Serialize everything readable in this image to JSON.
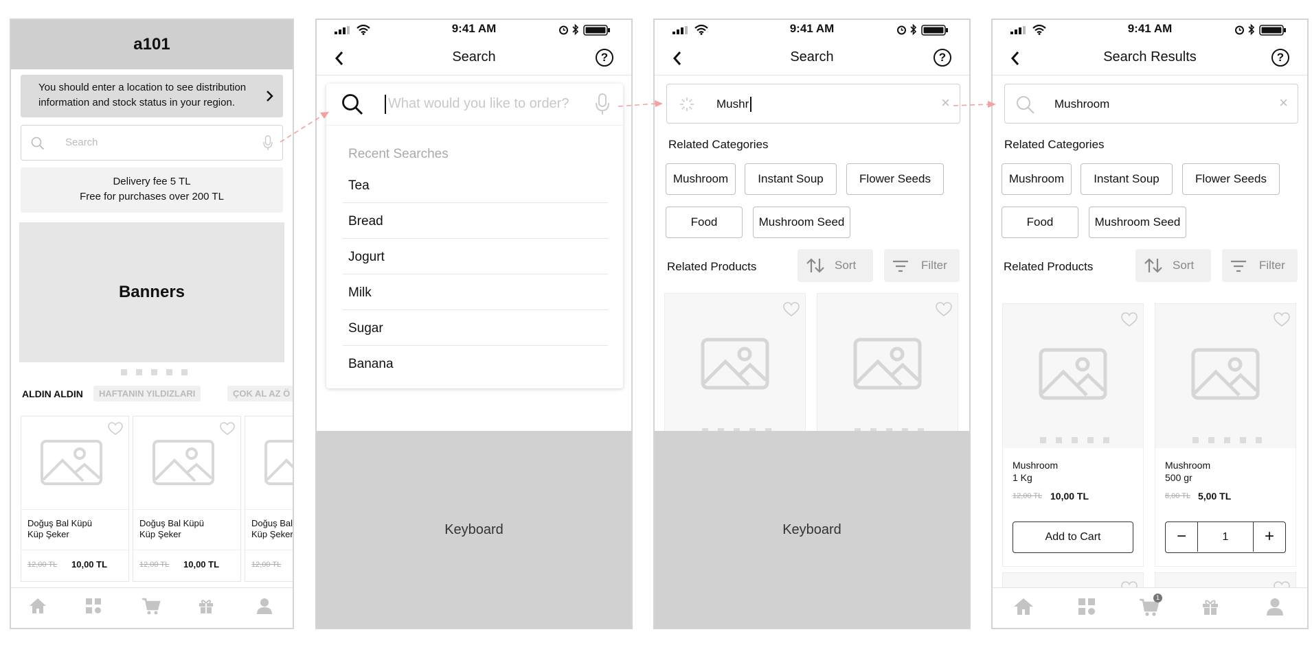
{
  "screen1": {
    "app_title": "a101",
    "location_notice": "You should enter a location to see distribution information and stock status in your region.",
    "search_placeholder": "Search",
    "delivery_line1": "Delivery fee 5 TL",
    "delivery_line2": "Free for purchases over 200 TL",
    "banners_label": "Banners",
    "tabs": [
      "ALDIN ALDIN",
      "HAFTANIN YILDIZLARI",
      "ÇOK AL AZ Ö"
    ],
    "products": [
      {
        "name_line1": "Doğuş Bal Küpü",
        "name_line2": "Küp Şeker",
        "old_price": "12,00 TL",
        "price": "10,00 TL"
      },
      {
        "name_line1": "Doğuş Bal Küpü",
        "name_line2": "Küp Şeker",
        "old_price": "12,00 TL",
        "price": "10,00 TL"
      },
      {
        "name_line1": "Doğuş Bal",
        "name_line2": "Küp Şeker",
        "old_price": "12,00 TL",
        "price": ""
      }
    ]
  },
  "status_bar": {
    "time": "9:41 AM"
  },
  "screen2": {
    "nav_title": "Search",
    "search_placeholder": "What would you like to order?",
    "recent_title": "Recent Searches",
    "recent_items": [
      "Tea",
      "Bread",
      "Jogurt",
      "Milk",
      "Sugar",
      "Banana"
    ],
    "keyboard_label": "Keyboard"
  },
  "screen3": {
    "nav_title": "Search",
    "search_value": "Mushr",
    "related_categories_title": "Related Categories",
    "categories": [
      "Mushroom",
      "Instant Soup",
      "Flower Seeds",
      "Food",
      "Mushroom Seed"
    ],
    "related_products_title": "Related Products",
    "sort_label": "Sort",
    "filter_label": "Filter",
    "keyboard_label": "Keyboard"
  },
  "screen4": {
    "nav_title": "Search Results",
    "search_value": "Mushroom",
    "related_categories_title": "Related Categories",
    "categories": [
      "Mushroom",
      "Instant Soup",
      "Flower Seeds",
      "Food",
      "Mushroom Seed"
    ],
    "related_products_title": "Related Products",
    "sort_label": "Sort",
    "filter_label": "Filter",
    "products": [
      {
        "name_line1": "Mushroom",
        "name_line2": "1 Kg",
        "old_price": "12,00 TL",
        "price": "10,00 TL",
        "button": "Add to Cart"
      },
      {
        "name_line1": "Mushroom",
        "name_line2": "500 gr",
        "old_price": "8,00 TL",
        "price": "5,00 TL",
        "quantity": "1"
      }
    ],
    "cart_badge": "1"
  },
  "colors": {
    "flow_arrow": "#f4a0a0",
    "placeholder_gray": "#c8c8c8",
    "header_gray": "#cfcfcf"
  },
  "icons": [
    "search-icon",
    "mic-icon",
    "back-icon",
    "help-icon",
    "heart-icon",
    "image-placeholder-icon",
    "sort-icon",
    "filter-icon",
    "home-icon",
    "categories-icon",
    "cart-icon",
    "gift-icon",
    "profile-icon",
    "clear-icon",
    "chevron-right-icon",
    "loading-spinner-icon"
  ]
}
